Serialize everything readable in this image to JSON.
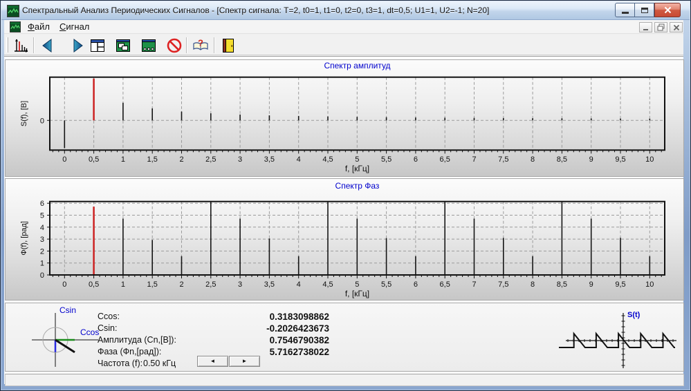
{
  "window": {
    "title": "Спектральный Анализ Периодических Сигналов - [Спектр сигнала: T=2, t0=1, t1=0, t2=0, t3=1, dt=0,5; U1=1, U2=-1; N=20]"
  },
  "menu": {
    "file_label": "Файл",
    "signal_label": "Сигнал"
  },
  "icons": {
    "toolbar": [
      "spectrum-chart-icon",
      "prev-arrow-icon",
      "next-arrow-icon",
      "tile-windows-icon",
      "cascade-windows-icon",
      "arrange-icons-icon",
      "stop-icon",
      "help-book-icon",
      "exit-door-icon"
    ],
    "window_controls": [
      "minimize-icon",
      "maximize-icon",
      "close-icon"
    ],
    "mdi_controls": [
      "mdi-minimize-icon",
      "mdi-restore-icon",
      "mdi-close-icon"
    ]
  },
  "chart_data": [
    {
      "type": "bar",
      "id": "amplitude_spectrum",
      "title": "Спектр амплитуд",
      "xlabel": "f, [кГц]",
      "ylabel": "S(f), [B]",
      "x_start": 0,
      "x_step_khz": 0.5,
      "x_tick_labels": [
        "0",
        "0,5",
        "1",
        "1,5",
        "2",
        "2,5",
        "3",
        "3,5",
        "4",
        "4,5",
        "5",
        "5,5",
        "6",
        "6,5",
        "7",
        "7,5",
        "8",
        "8,5",
        "9",
        "9,5",
        "10"
      ],
      "y_ticks": [
        0
      ],
      "y_tick_labels": [
        "0"
      ],
      "h_grid_values": [
        0
      ],
      "ylim": [
        -0.535,
        0.78
      ],
      "values": [
        -0.5,
        0.7547,
        0.3183,
        0.2169,
        0.1592,
        0.1278,
        0.1061,
        0.0911,
        0.0796,
        0.0709,
        0.0637,
        0.058,
        0.0531,
        0.049,
        0.0455,
        0.0425,
        0.0398,
        0.0375,
        0.0354,
        0.0335,
        0.0318
      ],
      "highlight_index": 1,
      "highlight_color": "#cc2222",
      "grid": "dashed",
      "legend": "none"
    },
    {
      "type": "bar",
      "id": "phase_spectrum",
      "title": "Спектр Фаз",
      "xlabel": "f, [кГц]",
      "ylabel": "Ф(f), [рад]",
      "x_start": 0,
      "x_step_khz": 0.5,
      "x_tick_labels": [
        "0",
        "0,5",
        "1",
        "1,5",
        "2",
        "2,5",
        "3",
        "3,5",
        "4",
        "4,5",
        "5",
        "5,5",
        "6",
        "6,5",
        "7",
        "7,5",
        "8",
        "8,5",
        "9",
        "9,5",
        "10"
      ],
      "y_ticks": [
        0,
        1,
        2,
        3,
        4,
        5,
        6
      ],
      "y_tick_labels": [
        "0",
        "1",
        "2",
        "3",
        "4",
        "5",
        "6"
      ],
      "h_grid_values": [
        1,
        2,
        3,
        4,
        5,
        6
      ],
      "ylim": [
        0,
        6.145
      ],
      "values": [
        0,
        5.7163,
        4.7124,
        2.9327,
        1.5708,
        6.1565,
        4.7124,
        3.0509,
        1.5708,
        6.2125,
        4.7124,
        3.0837,
        1.5708,
        6.2342,
        4.7124,
        3.0992,
        1.5708,
        6.2457,
        4.7124,
        3.1081,
        1.5708
      ],
      "highlight_index": 1,
      "highlight_color": "#cc2222",
      "grid": "dashed",
      "legend": "none"
    }
  ],
  "info_panel": {
    "ccos_label": "Ccos:",
    "ccos_value": "0.3183098862",
    "csin_label": "Csin:",
    "csin_value": "-0.2026423673",
    "amp_label": "Амплитуда (Cn,[B]):",
    "amp_value": "0.7546790382",
    "phase_label": "Фаза (Фn,[рад]):",
    "phase_value": "5.7162738022",
    "freq_label": "Частота (f):",
    "freq_value": "0.50 кГц",
    "prev_glyph": "◄",
    "next_glyph": "►",
    "vector_diagram": {
      "x_axis_label": "Ccos",
      "y_axis_label": "Csin",
      "ccos": 0.3183098862,
      "csin": -0.2026423673,
      "ccos_color": "#1a8c1a",
      "csin_color": "#2a2ae0",
      "vector_color": "#111111"
    },
    "signal_preview": {
      "label": "S(t)",
      "period": 2,
      "u1": 1,
      "u2": -1,
      "fall_time": 1
    }
  }
}
